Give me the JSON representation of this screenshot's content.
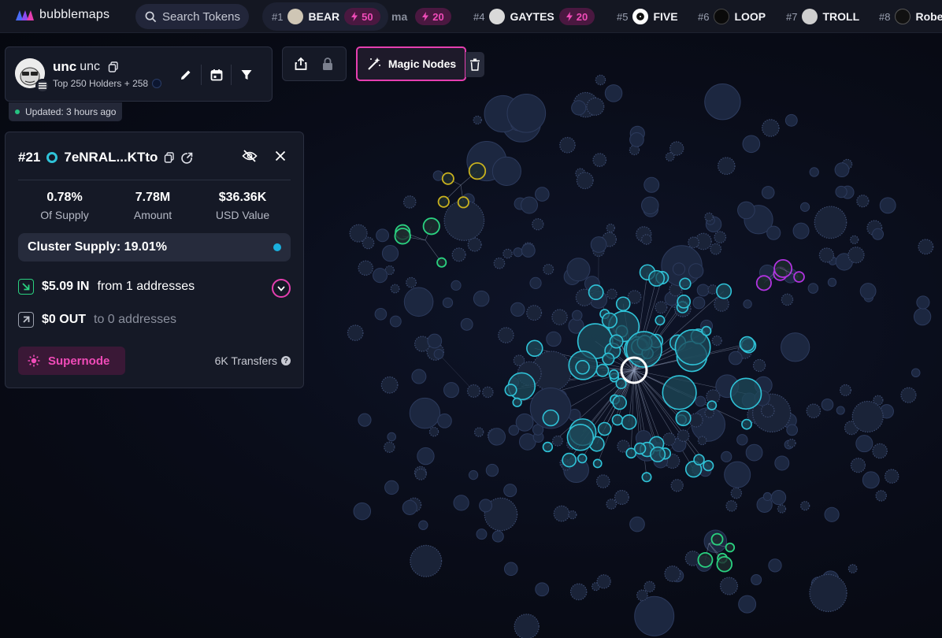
{
  "app": {
    "name": "bubblemaps"
  },
  "search": {
    "placeholder": "Search Tokens"
  },
  "tickers": [
    {
      "rank": "#1",
      "name": "BEAR",
      "boost": "50"
    },
    {
      "rank": "",
      "name": "ma",
      "boost": "20"
    },
    {
      "rank": "#4",
      "name": "GAYTES",
      "boost": "20"
    },
    {
      "rank": "#5",
      "name": "FIVE",
      "boost": ""
    },
    {
      "rank": "#6",
      "name": "LOOP",
      "boost": ""
    },
    {
      "rank": "#7",
      "name": "TROLL",
      "boost": ""
    },
    {
      "rank": "#8",
      "name": "Robe",
      "boost": ""
    }
  ],
  "token": {
    "symbol": "unc",
    "name": "unc",
    "holders_label": "Top 250 Holders + 258",
    "updated": "Updated: 3 hours ago"
  },
  "magic_nodes": {
    "label": "Magic Nodes"
  },
  "wallet": {
    "rank": "#21",
    "address": "7eNRAL...KTto",
    "stats": [
      {
        "value": "0.78%",
        "label": "Of Supply"
      },
      {
        "value": "7.78M",
        "label": "Amount"
      },
      {
        "value": "$36.36K",
        "label": "USD Value"
      }
    ],
    "cluster_supply": "Cluster Supply: 19.01%",
    "in_amount": "$5.09 IN",
    "in_from": "from 1 addresses",
    "out_amount": "$0 OUT",
    "out_to": "to 0 addresses",
    "supernode_label": "Supernode",
    "transfers": "6K Transfers"
  },
  "colors": {
    "accent_pink": "#e53fb0",
    "node_cyan": "#2fc3d8",
    "node_green": "#2ad180",
    "node_yellow": "#c9b21e",
    "node_purple": "#b033e0",
    "node_default": "#1c2740"
  }
}
